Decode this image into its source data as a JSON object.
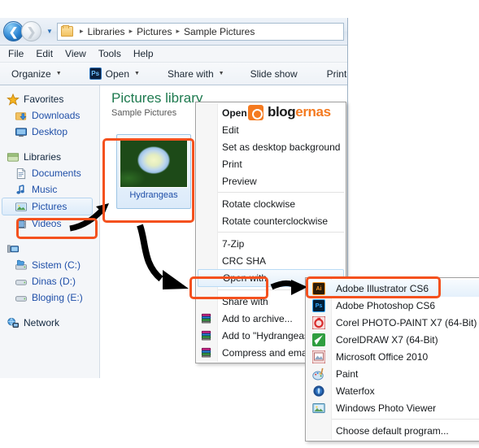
{
  "window": {
    "breadcrumb": [
      "Libraries",
      "Pictures",
      "Sample Pictures"
    ],
    "breadcrumb_separator": "▸",
    "nav": {
      "back_icon": "back-arrow-icon",
      "forward_icon": "forward-arrow-icon",
      "history_icon": "history-dropdown-icon",
      "folder_icon": "folder-icon"
    },
    "menubar": [
      "File",
      "Edit",
      "View",
      "Tools",
      "Help"
    ],
    "toolbar": [
      {
        "label": "Organize",
        "caret": true,
        "icon": null
      },
      {
        "label": "Open",
        "caret": true,
        "icon": "photoshop-badge",
        "icon_text": "Ps"
      },
      {
        "label": "Share with",
        "caret": true,
        "icon": null
      },
      {
        "label": "Slide show",
        "caret": false,
        "icon": null
      },
      {
        "label": "Print",
        "caret": false,
        "icon": null
      }
    ]
  },
  "navpane": {
    "groups": [
      {
        "root": {
          "label": "Favorites",
          "icon": "star-icon"
        },
        "items": [
          {
            "label": "Downloads",
            "icon": "downloads-icon",
            "selected": false
          },
          {
            "label": "Desktop",
            "icon": "desktop-icon",
            "selected": false
          }
        ]
      },
      {
        "root": {
          "label": "Libraries",
          "icon": "libraries-icon"
        },
        "items": [
          {
            "label": "Documents",
            "icon": "document-icon",
            "selected": false
          },
          {
            "label": "Music",
            "icon": "music-icon",
            "selected": false
          },
          {
            "label": "Pictures",
            "icon": "pictures-icon",
            "selected": true
          },
          {
            "label": "Videos",
            "icon": "video-icon",
            "selected": false
          }
        ]
      },
      {
        "root": {
          "label": "",
          "icon": "computer-icon"
        },
        "items": [
          {
            "label": "Sistem (C:)",
            "icon": "system-drive-icon",
            "selected": false
          },
          {
            "label": "Dinas (D:)",
            "icon": "drive-icon",
            "selected": false
          },
          {
            "label": "Bloging (E:)",
            "icon": "drive-icon",
            "selected": false
          }
        ]
      },
      {
        "root": {
          "label": "Network",
          "icon": "network-icon"
        },
        "items": []
      }
    ]
  },
  "content": {
    "library_title": "Pictures library",
    "library_subtitle": "Sample Pictures",
    "file": {
      "name": "Hydrangeas",
      "thumbnail": "hydrangeas-photo"
    }
  },
  "context_menu": {
    "items": [
      {
        "label": "Open",
        "bold": true,
        "type": "item"
      },
      {
        "label": "Edit",
        "bold": false,
        "type": "item"
      },
      {
        "label": "Set as desktop background",
        "bold": false,
        "type": "item"
      },
      {
        "label": "Print",
        "bold": false,
        "type": "item"
      },
      {
        "label": "Preview",
        "bold": false,
        "type": "item"
      },
      {
        "type": "separator"
      },
      {
        "label": "Rotate clockwise",
        "bold": false,
        "type": "item"
      },
      {
        "label": "Rotate counterclockwise",
        "bold": false,
        "type": "item"
      },
      {
        "type": "separator"
      },
      {
        "label": "7-Zip",
        "bold": false,
        "type": "item"
      },
      {
        "label": "CRC SHA",
        "bold": false,
        "type": "item"
      },
      {
        "label": "Open with",
        "bold": false,
        "type": "item",
        "hover": true,
        "highlighted": true
      },
      {
        "type": "separator"
      },
      {
        "label": "Share with",
        "bold": false,
        "type": "item"
      },
      {
        "label": "Add to archive...",
        "bold": false,
        "type": "item",
        "icon": "winrar-icon"
      },
      {
        "label": "Add to \"Hydrangeas.rar\"",
        "bold": false,
        "type": "item",
        "icon": "winrar-icon"
      },
      {
        "label": "Compress and email...",
        "bold": false,
        "type": "item",
        "icon": "winrar-icon"
      }
    ]
  },
  "open_with_submenu": {
    "items": [
      {
        "label": "Adobe Illustrator CS6",
        "icon": "illustrator-icon",
        "icon_text": "Ai",
        "color": "#f79420",
        "bg": "#2b1a06",
        "highlighted": true
      },
      {
        "label": "Adobe Photoshop CS6",
        "icon": "photoshop-icon",
        "icon_text": "Ps",
        "color": "#31a8ff",
        "bg": "#001e36"
      },
      {
        "label": "Corel PHOTO-PAINT X7 (64-Bit)",
        "icon": "corel-photopaint-icon",
        "icon_text": "",
        "color": "#ffffff",
        "bg": "#d92b2b"
      },
      {
        "label": "CorelDRAW X7 (64-Bit)",
        "icon": "coreldraw-icon",
        "icon_text": "",
        "color": "#ffffff",
        "bg": "#2f9e3f"
      },
      {
        "label": "Microsoft Office 2010",
        "icon": "ms-office-icon",
        "icon_text": "",
        "color": "#ffffff",
        "bg": "#d96a6a"
      },
      {
        "label": "Paint",
        "icon": "paint-icon",
        "icon_text": "",
        "color": "#ffffff",
        "bg": "#d8e7f2"
      },
      {
        "label": "Waterfox",
        "icon": "waterfox-icon",
        "icon_text": "",
        "color": "#ffffff",
        "bg": "#1f4f8f"
      },
      {
        "label": "Windows Photo Viewer",
        "icon": "photo-viewer-icon",
        "icon_text": "",
        "color": "#ffffff",
        "bg": "#7fb8d8"
      },
      {
        "type": "separator"
      },
      {
        "label": "Choose default program...",
        "icon": null
      }
    ]
  },
  "watermark": {
    "brand_part1": "blog",
    "brand_part2": "ernas",
    "logo": "blogernas-logo"
  },
  "annotations": {
    "accent_color": "#f4511e",
    "boxes": [
      {
        "name": "pictures-sidebar-highlight"
      },
      {
        "name": "thumbnail-highlight"
      },
      {
        "name": "open-with-highlight"
      },
      {
        "name": "illustrator-highlight"
      }
    ],
    "arrows": [
      {
        "name": "arrow-to-thumbnail"
      },
      {
        "name": "arrow-thumbnail-to-openwith"
      },
      {
        "name": "arrow-openwith-to-illustrator"
      }
    ]
  }
}
